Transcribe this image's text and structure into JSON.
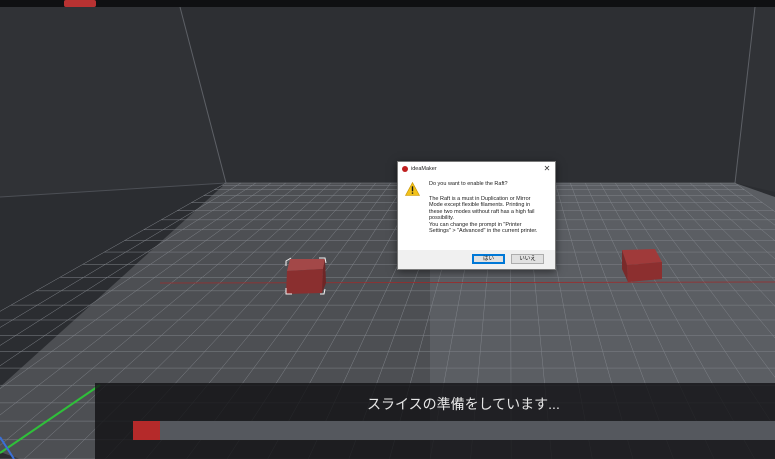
{
  "topbar": {
    "menu_items": [
      "",
      "",
      "",
      "",
      "",
      "",
      "",
      "",
      "",
      "",
      "",
      "",
      "",
      "",
      "",
      ""
    ],
    "active_index": 2
  },
  "dialog": {
    "title": "ideaMaker",
    "close_glyph": "✕",
    "question": "Do you want to enable the Raft?",
    "body_lines": [
      "The Raft is a must in Duplication or Mirror",
      "Mode except flexible filaments. Printing in",
      "these two modes without raft has a high fail",
      "possibility.",
      "You can change the prompt in \"Printer",
      "Settings\" > \"Advanced\" in the current printer."
    ],
    "yes_label": "はい",
    "no_label": "いいえ"
  },
  "slice": {
    "status_text": "スライスの準備をしています...",
    "progress": 0.042
  },
  "colors": {
    "accent": "#b52a2a",
    "model": "#8c3030",
    "background": "#2b2d31"
  }
}
